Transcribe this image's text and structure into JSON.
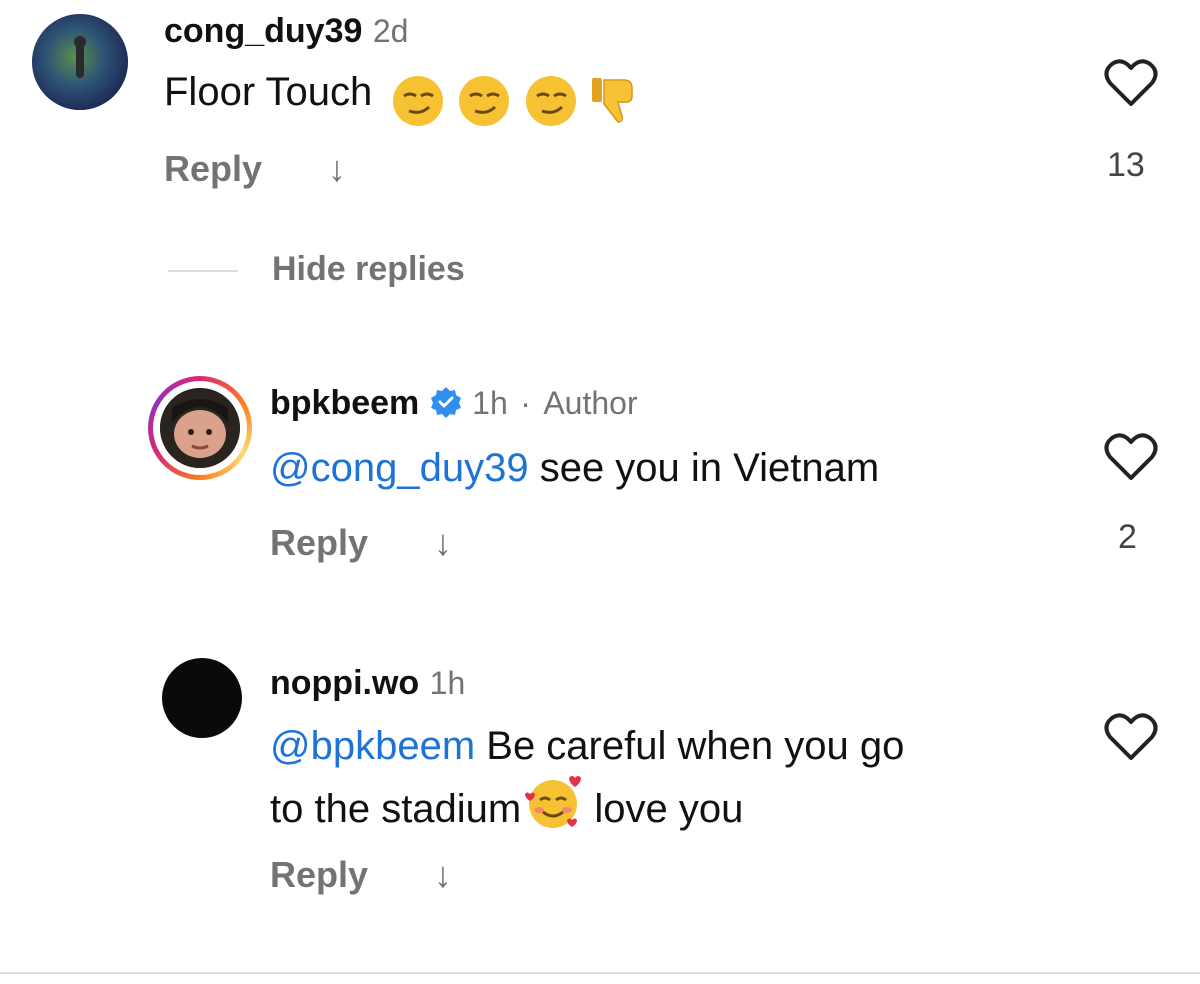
{
  "comment1": {
    "username": "cong_duy39",
    "time": "2d",
    "text": "Floor Touch",
    "reply_label": "Reply",
    "like_count": "13"
  },
  "hide_replies_label": "Hide replies",
  "reply1": {
    "username": "bpkbeem",
    "time": "1h",
    "separator": "·",
    "role": "Author",
    "mention": "@cong_duy39",
    "text": " see you in Vietnam",
    "reply_label": "Reply",
    "like_count": "2"
  },
  "reply2": {
    "username": "noppi.wo",
    "time": "1h",
    "mention": "@bpkbeem",
    "text_line1": " Be careful when you go",
    "text_line2": "to the stadium",
    "text_after_emoji": " love you",
    "reply_label": "Reply"
  },
  "colors": {
    "mention": "#1d73d6",
    "muted": "#737373",
    "verified": "#2f8fef"
  },
  "icons": [
    "smirk-emoji",
    "thumbs-down-emoji",
    "verified-badge-icon",
    "heart-outline-icon",
    "down-arrow-icon",
    "smiling-hearts-emoji"
  ]
}
